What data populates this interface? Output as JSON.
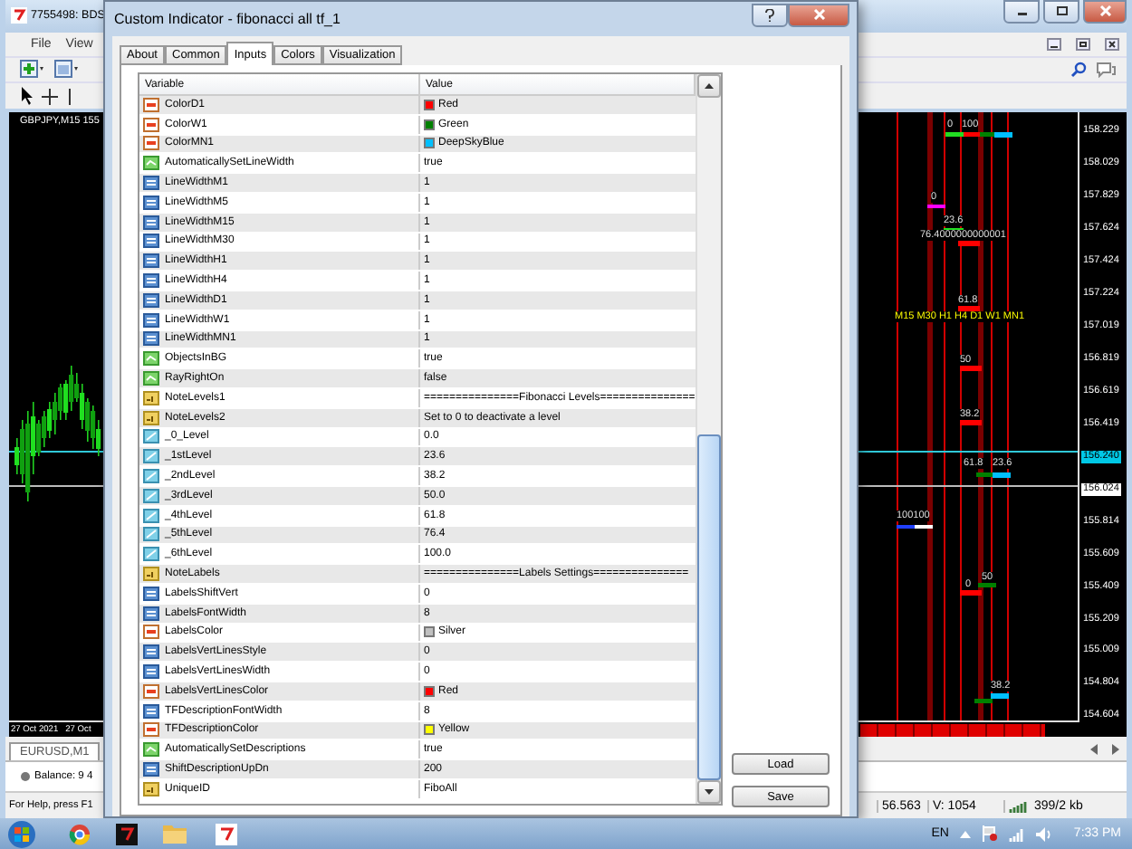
{
  "app": {
    "title": "7755498: BDS",
    "menu": [
      "File",
      "View"
    ],
    "chart": {
      "title": "GBPJPY,M15 155",
      "labels": [
        {
          "text": "0",
          "kind": "level"
        },
        {
          "text": "100",
          "kind": "level"
        },
        {
          "text": "0",
          "kind": "level"
        },
        {
          "text": "23.6",
          "kind": "level"
        },
        {
          "text": "76.4000000000001",
          "kind": "level"
        },
        {
          "text": "61.8",
          "kind": "level"
        },
        {
          "text": "M15 M30 H1 H4 D1 W1 MN1",
          "kind": "timeframes"
        },
        {
          "text": "50",
          "kind": "level"
        },
        {
          "text": "38.2",
          "kind": "level"
        },
        {
          "text": "61.8",
          "kind": "level"
        },
        {
          "text": "23.6",
          "kind": "level"
        },
        {
          "text": "100100",
          "kind": "level"
        },
        {
          "text": "0",
          "kind": "level"
        },
        {
          "text": "50",
          "kind": "level"
        },
        {
          "text": "38.2",
          "kind": "level"
        }
      ],
      "price_ticks": [
        {
          "text": "158.229",
          "kind": "tick"
        },
        {
          "text": "158.029",
          "kind": "tick"
        },
        {
          "text": "157.829",
          "kind": "tick"
        },
        {
          "text": "157.624",
          "kind": "tick"
        },
        {
          "text": "157.424",
          "kind": "tick"
        },
        {
          "text": "157.224",
          "kind": "tick"
        },
        {
          "text": "157.019",
          "kind": "tick"
        },
        {
          "text": "156.819",
          "kind": "tick"
        },
        {
          "text": "156.619",
          "kind": "tick"
        },
        {
          "text": "156.419",
          "kind": "tick"
        },
        {
          "text": "156.240",
          "kind": "bid"
        },
        {
          "text": "156.024",
          "kind": "ask"
        },
        {
          "text": "155.814",
          "kind": "tick"
        },
        {
          "text": "155.609",
          "kind": "tick"
        },
        {
          "text": "155.409",
          "kind": "tick"
        },
        {
          "text": "155.209",
          "kind": "tick"
        },
        {
          "text": "155.009",
          "kind": "tick"
        },
        {
          "text": "154.804",
          "kind": "tick"
        },
        {
          "text": "154.604",
          "kind": "tick"
        }
      ],
      "dates": [
        "27 Oct 2021",
        "27 Oct"
      ]
    },
    "chart_tab": {
      "label": "EURUSD,M1",
      "selected": true
    },
    "terminal": {
      "balance": "Balance: 9 4"
    },
    "status_bar": {
      "help": "For Help, press F1",
      "price": "56.563",
      "volume": "V: 1054",
      "traffic": "399/2 kb"
    }
  },
  "dialog": {
    "title": "Custom Indicator - fibonacci all tf_1",
    "tabs": [
      {
        "label": "About",
        "selected": false
      },
      {
        "label": "Common",
        "selected": false
      },
      {
        "label": "Inputs",
        "selected": true
      },
      {
        "label": "Colors",
        "selected": false
      },
      {
        "label": "Visualization",
        "selected": false
      }
    ],
    "columns": [
      "Variable",
      "Value"
    ],
    "rows": [
      {
        "kind": "color",
        "variable": "ColorD1",
        "value": "Red",
        "color": "#ff0000"
      },
      {
        "kind": "color",
        "variable": "ColorW1",
        "value": "Green",
        "color": "#008000"
      },
      {
        "kind": "color",
        "variable": "ColorMN1",
        "value": "DeepSkyBlue",
        "color": "#00bfff"
      },
      {
        "kind": "bool",
        "variable": "AutomaticallySetLineWidth",
        "value": "true"
      },
      {
        "kind": "int",
        "variable": "LineWidthM1",
        "value": "1"
      },
      {
        "kind": "int",
        "variable": "LineWidthM5",
        "value": "1"
      },
      {
        "kind": "int",
        "variable": "LineWidthM15",
        "value": "1"
      },
      {
        "kind": "int",
        "variable": "LineWidthM30",
        "value": "1"
      },
      {
        "kind": "int",
        "variable": "LineWidthH1",
        "value": "1"
      },
      {
        "kind": "int",
        "variable": "LineWidthH4",
        "value": "1"
      },
      {
        "kind": "int",
        "variable": "LineWidthD1",
        "value": "1"
      },
      {
        "kind": "int",
        "variable": "LineWidthW1",
        "value": "1"
      },
      {
        "kind": "int",
        "variable": "LineWidthMN1",
        "value": "1"
      },
      {
        "kind": "bool",
        "variable": "ObjectsInBG",
        "value": "true"
      },
      {
        "kind": "bool",
        "variable": "RayRightOn",
        "value": "false"
      },
      {
        "kind": "string",
        "variable": "NoteLevels1",
        "value": "===============Fibonacci Levels==============="
      },
      {
        "kind": "string",
        "variable": "NoteLevels2",
        "value": "Set to 0 to deactivate a level"
      },
      {
        "kind": "double",
        "variable": "_0_Level",
        "value": "0.0"
      },
      {
        "kind": "double",
        "variable": "_1stLevel",
        "value": "23.6"
      },
      {
        "kind": "double",
        "variable": "_2ndLevel",
        "value": "38.2"
      },
      {
        "kind": "double",
        "variable": "_3rdLevel",
        "value": "50.0"
      },
      {
        "kind": "double",
        "variable": "_4thLevel",
        "value": "61.8"
      },
      {
        "kind": "double",
        "variable": "_5thLevel",
        "value": "76.4"
      },
      {
        "kind": "double",
        "variable": "_6thLevel",
        "value": "100.0"
      },
      {
        "kind": "string",
        "variable": "NoteLabels",
        "value": "===============Labels Settings==============="
      },
      {
        "kind": "int",
        "variable": "LabelsShiftVert",
        "value": "0"
      },
      {
        "kind": "int",
        "variable": "LabelsFontWidth",
        "value": "8"
      },
      {
        "kind": "color",
        "variable": "LabelsColor",
        "value": "Silver",
        "color": "#c0c0c0"
      },
      {
        "kind": "int",
        "variable": "LabelsVertLinesStyle",
        "value": "0"
      },
      {
        "kind": "int",
        "variable": "LabelsVertLinesWidth",
        "value": "0"
      },
      {
        "kind": "color",
        "variable": "LabelsVertLinesColor",
        "value": "Red",
        "color": "#ff0000"
      },
      {
        "kind": "int",
        "variable": "TFDescriptionFontWidth",
        "value": "8"
      },
      {
        "kind": "color",
        "variable": "TFDescriptionColor",
        "value": "Yellow",
        "color": "#ffff00"
      },
      {
        "kind": "bool",
        "variable": "AutomaticallySetDescriptions",
        "value": "true"
      },
      {
        "kind": "int",
        "variable": "ShiftDescriptionUpDn",
        "value": "200"
      },
      {
        "kind": "string",
        "variable": "UniqueID",
        "value": "FiboAll"
      }
    ],
    "buttons": [
      "Load",
      "Save"
    ]
  },
  "taskbar": {
    "language": "EN",
    "time": "7:33 PM"
  }
}
